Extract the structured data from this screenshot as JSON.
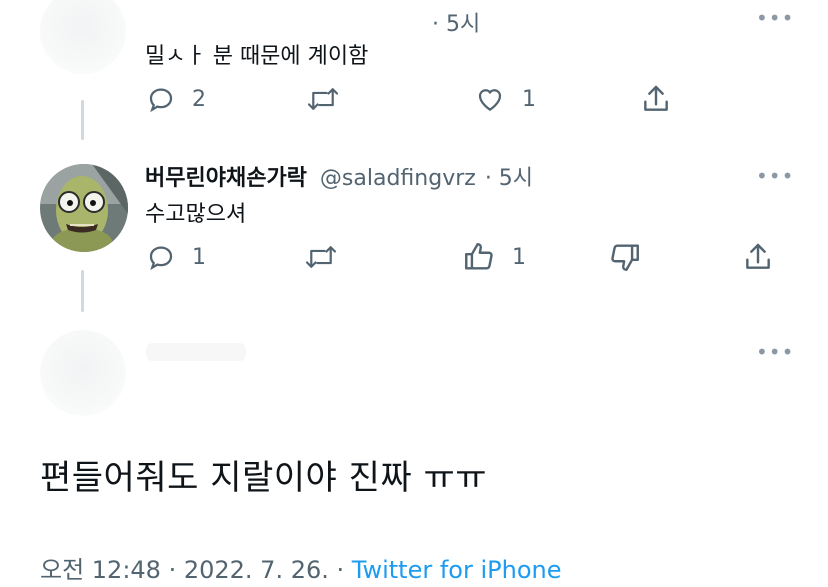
{
  "tweet1": {
    "time": "· 5시",
    "text": "밀ㅅㅏ 분 때문에 계이함",
    "reply_count": "2",
    "like_count": "1",
    "more": "•••"
  },
  "tweet2": {
    "display_name": "버무린야채손가락",
    "handle": "@saladfingvrz",
    "time": "· 5시",
    "text": "수고많으셔",
    "reply_count": "1",
    "upvote_count": "1",
    "more": "•••"
  },
  "tweet3": {
    "more": "•••"
  },
  "main_tweet": {
    "text": "편들어줘도 지랄이야 진짜 ㅠㅠ",
    "date_time": "오전 12:48 · 2022. 7. 26. · ",
    "source": "Twitter for iPhone"
  },
  "colors": {
    "text": "#0f1419",
    "muted": "#536471",
    "link": "#1d9bf0",
    "thread_line": "#cfd9de"
  }
}
